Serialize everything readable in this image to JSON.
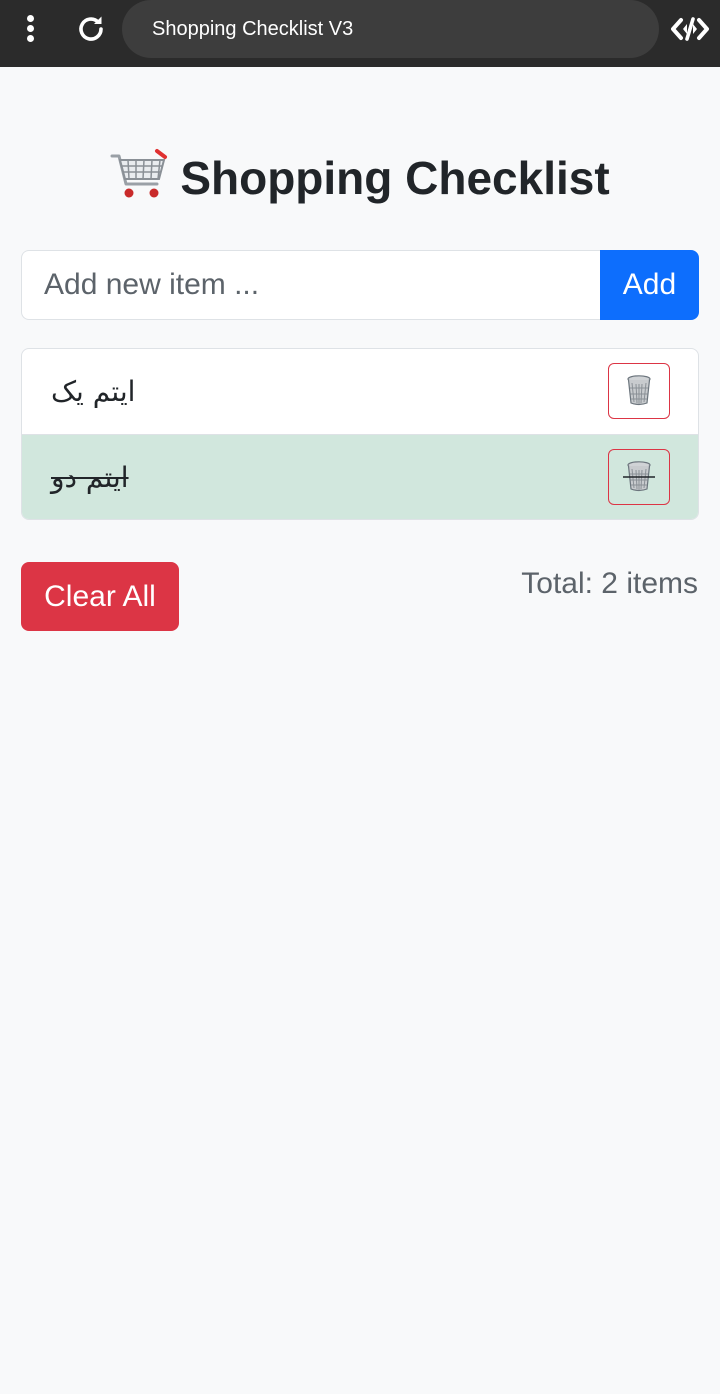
{
  "browser": {
    "tab_title": "Shopping Checklist V3"
  },
  "page": {
    "title_emoji": "🛒",
    "title": "Shopping Checklist"
  },
  "add_form": {
    "placeholder": "Add new item ...",
    "value": "",
    "add_label": "Add"
  },
  "items": [
    {
      "text": "ایتم یک",
      "done": false
    },
    {
      "text": "ایتم دو",
      "done": true
    }
  ],
  "footer": {
    "clear_label": "Clear All",
    "total_text": "Total: 2 items"
  },
  "colors": {
    "primary": "#0d6efd",
    "danger": "#dc3545",
    "done_row": "#d1e7dd",
    "background": "#f8f9fa",
    "topbar": "#2b2b2b"
  },
  "icons": {
    "menu": "vertical-dots-icon",
    "reload": "reload-icon",
    "devtools": "code-icon",
    "cart": "shopping-cart-icon",
    "delete": "wastebasket-icon"
  }
}
